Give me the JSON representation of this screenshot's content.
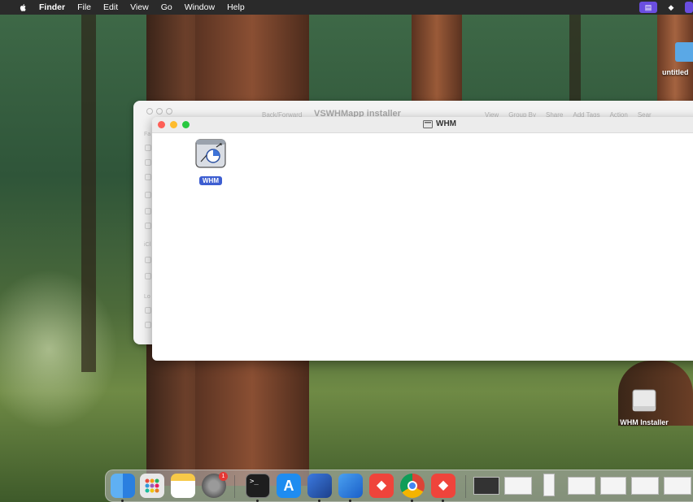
{
  "menubar": {
    "app_name": "Finder",
    "items": [
      "File",
      "Edit",
      "View",
      "Go",
      "Window",
      "Help"
    ]
  },
  "back_window": {
    "title": "VSWHMapp installer",
    "breadcrumb": "Back/Forward",
    "actions": [
      "View",
      "Group By",
      "Share",
      "Add Tags",
      "Action",
      "Sear"
    ],
    "sidebar_labels": [
      "Fa",
      "iCl",
      "Lo"
    ]
  },
  "front_window": {
    "title": "WHM",
    "item_label": "WHM"
  },
  "desktop": {
    "folder_label": "untitled",
    "installer_label": "WHM Installer"
  },
  "dock": {
    "settings_badge": "1",
    "apps": [
      "finder-icon",
      "launchpad-icon",
      "notes-icon",
      "system-settings-icon",
      "terminal-icon",
      "app-store-icon",
      "xcode-icon",
      "simulator-icon",
      "anydesk-icon",
      "chrome-icon",
      "anydesk-installer-icon"
    ]
  },
  "colors": {
    "selection": "#3d5ed1",
    "close": "#fe5f57",
    "minimize": "#febc2e",
    "zoom": "#28c840"
  }
}
